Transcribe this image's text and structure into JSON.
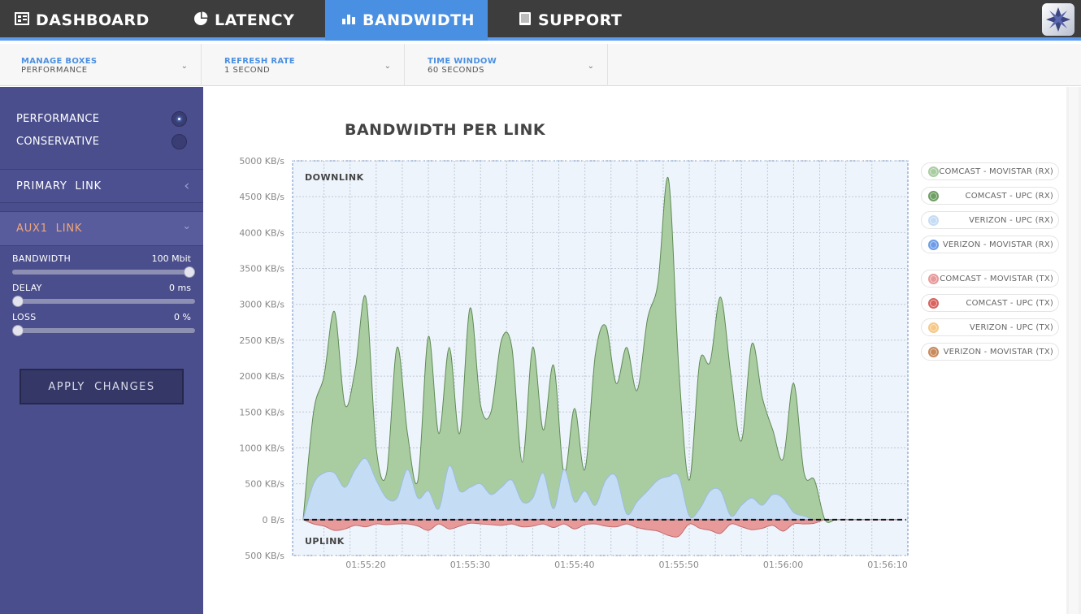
{
  "nav": {
    "tabs": [
      {
        "label": "DASHBOARD",
        "icon": "dashboard-icon"
      },
      {
        "label": "LATENCY",
        "icon": "pie-chart-icon"
      },
      {
        "label": "BANDWIDTH",
        "icon": "bar-chart-icon"
      },
      {
        "label": "SUPPORT",
        "icon": "book-icon"
      }
    ],
    "active_tab": "BANDWIDTH",
    "logo_icon": "star-logo-icon"
  },
  "toolbar": {
    "manage_boxes": {
      "label": "MANAGE BOXES",
      "value": "PERFORMANCE"
    },
    "refresh_rate": {
      "label": "REFRESH RATE",
      "value": "1 SECOND"
    },
    "time_window": {
      "label": "TIME WINDOW",
      "value": "60 SECONDS"
    }
  },
  "sidebar": {
    "profiles": [
      {
        "label": "PERFORMANCE",
        "selected": true
      },
      {
        "label": "CONSERVATIVE",
        "selected": false
      }
    ],
    "primary_link": "PRIMARY  LINK",
    "aux_link": "AUX1  LINK",
    "sliders": [
      {
        "name": "BANDWIDTH",
        "value": "100 Mbit",
        "level": 1.0
      },
      {
        "name": "DELAY",
        "value": "0 ms",
        "level": 0.0
      },
      {
        "name": "LOSS",
        "value": "0 %",
        "level": 0.0
      }
    ],
    "apply_label": "APPLY  CHANGES"
  },
  "colors": {
    "accent": "#4a90e2",
    "sidebar": "#4a4e8c",
    "nav": "#3d3d3d",
    "aux_link_text": "#f0a77a"
  },
  "chart_data": {
    "type": "area",
    "title": "BANDWIDTH PER LINK",
    "downlink_label": "DOWNLINK",
    "uplink_label": "UPLINK",
    "ylim": [
      -500,
      5000
    ],
    "y_ticks": [
      "5000 KB/s",
      "4500 KB/s",
      "4000 KB/s",
      "3500 KB/s",
      "3000 KB/s",
      "2500 KB/s",
      "2000 KB/s",
      "1500 KB/s",
      "1000 KB/s",
      "500 KB/s",
      "0 B/s",
      "500 KB/s"
    ],
    "y_tick_values": [
      5000,
      4500,
      4000,
      3500,
      3000,
      2500,
      2000,
      1500,
      1000,
      500,
      0,
      -500
    ],
    "x_ticks": [
      "01:55:20",
      "01:55:30",
      "01:55:40",
      "01:55:50",
      "01:56:00",
      "01:56:10"
    ],
    "x_tick_seconds": [
      20,
      30,
      40,
      50,
      60,
      70
    ],
    "grid": true,
    "legend_placement": "right",
    "x_seconds": [
      14,
      15,
      16,
      17,
      18,
      19,
      20,
      21,
      22,
      23,
      24,
      25,
      26,
      27,
      28,
      29,
      30,
      31,
      32,
      33,
      34,
      35,
      36,
      37,
      38,
      39,
      40,
      41,
      42,
      43,
      44,
      45,
      46,
      47,
      48,
      49,
      50,
      51,
      52,
      53,
      54,
      55,
      56,
      57,
      58,
      59,
      60,
      61,
      62,
      63,
      64,
      65,
      66,
      67,
      68,
      69,
      70,
      71
    ],
    "series": [
      {
        "name": "COMCAST - MOVISTAR (RX)",
        "color": "#a9cda0",
        "values": [
          0,
          1500,
          2000,
          2900,
          1600,
          2100,
          3100,
          1000,
          650,
          2400,
          1200,
          550,
          2550,
          1200,
          2400,
          1200,
          2950,
          1600,
          1500,
          2500,
          2400,
          800,
          2400,
          1250,
          2150,
          650,
          1550,
          700,
          2300,
          2700,
          1900,
          2400,
          1800,
          2800,
          3300,
          4750,
          2100,
          550,
          2200,
          2200,
          3100,
          2000,
          1100,
          2450,
          1700,
          1250,
          850,
          1900,
          650,
          550,
          0,
          0,
          0,
          0,
          0,
          0,
          0,
          0
        ],
        "stack_with_below": true
      },
      {
        "name": "COMCAST - UPC (RX)",
        "color": "#6f9e64",
        "values": [
          0,
          0,
          0,
          0,
          0,
          0,
          0,
          0,
          0,
          0,
          0,
          0,
          0,
          0,
          0,
          0,
          0,
          0,
          0,
          0,
          0,
          0,
          0,
          0,
          0,
          0,
          0,
          0,
          0,
          0,
          0,
          0,
          0,
          0,
          0,
          0,
          0,
          0,
          0,
          0,
          0,
          0,
          0,
          0,
          0,
          0,
          0,
          0,
          0,
          0,
          0,
          0,
          0,
          0,
          0,
          0,
          0,
          0
        ]
      },
      {
        "name": "VERIZON - UPC (RX)",
        "color": "#c5dcf5",
        "values": [
          0,
          500,
          650,
          650,
          450,
          700,
          850,
          550,
          300,
          300,
          700,
          300,
          400,
          150,
          750,
          400,
          450,
          500,
          350,
          450,
          550,
          250,
          300,
          650,
          150,
          700,
          250,
          400,
          200,
          550,
          600,
          80,
          250,
          400,
          550,
          600,
          600,
          50,
          150,
          400,
          400,
          50,
          200,
          300,
          200,
          350,
          300,
          100,
          50,
          0,
          0,
          0,
          0,
          0,
          0,
          0,
          0,
          0
        ]
      },
      {
        "name": "VERIZON - MOVISTAR (RX)",
        "color": "#6d9de8",
        "values": [
          0,
          0,
          0,
          0,
          0,
          0,
          0,
          0,
          0,
          0,
          0,
          0,
          0,
          0,
          0,
          0,
          0,
          0,
          0,
          0,
          0,
          0,
          0,
          0,
          0,
          0,
          0,
          0,
          0,
          0,
          0,
          0,
          0,
          0,
          0,
          0,
          0,
          0,
          0,
          0,
          0,
          0,
          0,
          0,
          0,
          0,
          0,
          0,
          0,
          0,
          0,
          0,
          0,
          0,
          0,
          0,
          0,
          0
        ]
      },
      {
        "name": "COMCAST - MOVISTAR (TX)",
        "color": "#e89a9a",
        "values": [
          0,
          -60,
          -90,
          -150,
          -130,
          -80,
          -100,
          -60,
          -70,
          -60,
          -60,
          -90,
          -150,
          -60,
          -130,
          -90,
          -50,
          -60,
          -70,
          -80,
          -60,
          -100,
          -90,
          -60,
          -110,
          -60,
          -130,
          -70,
          -60,
          -90,
          -100,
          -60,
          -110,
          -140,
          -160,
          -220,
          -230,
          -60,
          -120,
          -150,
          -190,
          -60,
          -100,
          -140,
          -120,
          -80,
          -160,
          -60,
          -60,
          -50,
          0,
          0,
          0,
          0,
          0,
          0,
          0,
          0
        ]
      },
      {
        "name": "COMCAST - UPC (TX)",
        "color": "#d9635e",
        "values": [
          0,
          0,
          0,
          0,
          0,
          0,
          0,
          0,
          0,
          0,
          0,
          0,
          0,
          0,
          0,
          0,
          0,
          0,
          0,
          0,
          0,
          0,
          0,
          0,
          0,
          0,
          0,
          0,
          0,
          0,
          0,
          0,
          0,
          0,
          0,
          0,
          0,
          0,
          0,
          0,
          0,
          0,
          0,
          0,
          0,
          0,
          0,
          0,
          0,
          0,
          0,
          0,
          0,
          0,
          0,
          0,
          0,
          0
        ]
      },
      {
        "name": "VERIZON - UPC (TX)",
        "color": "#f5c987",
        "values": [
          0,
          0,
          0,
          0,
          0,
          0,
          0,
          0,
          0,
          0,
          0,
          0,
          0,
          0,
          0,
          0,
          0,
          0,
          0,
          0,
          0,
          0,
          0,
          0,
          0,
          0,
          0,
          0,
          0,
          0,
          0,
          0,
          0,
          0,
          0,
          0,
          0,
          0,
          0,
          0,
          0,
          0,
          0,
          0,
          0,
          0,
          0,
          0,
          0,
          0,
          0,
          0,
          0,
          0,
          0,
          0,
          0,
          0
        ]
      },
      {
        "name": "VERIZON - MOVISTAR (TX)",
        "color": "#c98a5e",
        "values": [
          0,
          0,
          0,
          0,
          0,
          0,
          0,
          0,
          0,
          0,
          0,
          0,
          0,
          0,
          0,
          0,
          0,
          0,
          0,
          0,
          0,
          0,
          0,
          0,
          0,
          0,
          0,
          0,
          0,
          0,
          0,
          0,
          0,
          0,
          0,
          0,
          0,
          0,
          0,
          0,
          0,
          0,
          0,
          0,
          0,
          0,
          0,
          0,
          0,
          0,
          0,
          0,
          0,
          0,
          0,
          0,
          0,
          0
        ]
      }
    ]
  }
}
